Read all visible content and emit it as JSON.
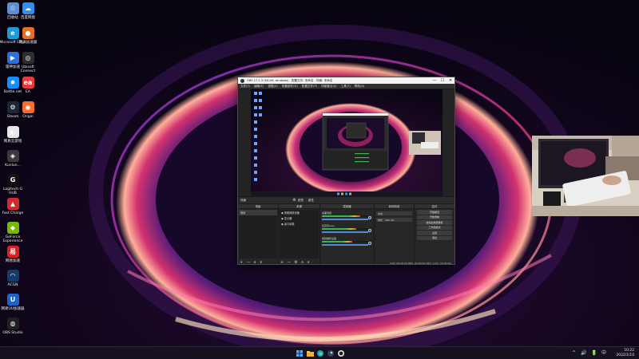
{
  "desktop": {
    "icons": [
      {
        "label": "回收站",
        "icon": "recycle-bin-icon",
        "color": "#5b8fd6",
        "glyph": "♲"
      },
      {
        "label": "百度网盘",
        "icon": "cloud-drive-icon",
        "color": "#2f8ef2",
        "glyph": "☁"
      },
      {
        "label": "Microsoft Edge",
        "icon": "edge-icon",
        "color": "#1f9ad8",
        "glyph": "e"
      },
      {
        "label": "腾讯加速器",
        "icon": "accelerator-icon",
        "color": "#e46f2a",
        "glyph": "●"
      },
      {
        "label": "雷神加速",
        "icon": "thunder-icon",
        "color": "#2c6fe0",
        "glyph": "▶"
      },
      {
        "label": "Ubisoft Connect",
        "icon": "ubisoft-icon",
        "color": "#2e2e2e",
        "glyph": "◎"
      },
      {
        "label": "Battle.net",
        "icon": "battlenet-icon",
        "color": "#148eff",
        "glyph": "✹"
      },
      {
        "label": "EA",
        "icon": "ea-icon",
        "color": "#e23b3b",
        "glyph": "ea"
      },
      {
        "label": "Steam",
        "icon": "steam-icon",
        "color": "#1b2838",
        "glyph": "⚙"
      },
      {
        "label": "Origin",
        "icon": "origin-icon",
        "color": "#f56c2d",
        "glyph": "◉"
      },
      {
        "label": "网易云游戏",
        "icon": "netease-cloud-icon",
        "color": "#e7e7e7",
        "glyph": "◐"
      },
      {
        "label": "Kunlun...",
        "icon": "kunlun-icon",
        "color": "#3a3a3a",
        "glyph": "◈"
      },
      {
        "label": "Logitech G HUB",
        "icon": "logitech-icon",
        "color": "#111111",
        "glyph": "G"
      },
      {
        "label": "Fast Charge",
        "icon": "fast-charge-icon",
        "color": "#d42a2a",
        "glyph": "▲"
      },
      {
        "label": "GeForce Experience",
        "icon": "geforce-icon",
        "color": "#76b900",
        "glyph": "◆"
      },
      {
        "label": "网易加速",
        "icon": "netease-acc-icon",
        "color": "#d92121",
        "glyph": "易"
      },
      {
        "label": "ACGN",
        "icon": "acgn-icon",
        "color": "#183a6a",
        "glyph": "◠"
      },
      {
        "label": "网易UU加速器",
        "icon": "uu-icon",
        "color": "#1e63c7",
        "glyph": "U"
      },
      {
        "label": "OBS Studio",
        "icon": "obs-icon",
        "color": "#202020",
        "glyph": "◍"
      }
    ]
  },
  "obs": {
    "title": "OBS 27.1.3 (64-bit, windows) - 配置文件: 未命名 - 场景: 未命名",
    "window_controls": {
      "minimize": "—",
      "maximize": "☐",
      "close": "✕"
    },
    "menu": [
      "文件(F)",
      "编辑(E)",
      "视图(V)",
      "停靠部件(D)",
      "配置文件(P)",
      "场景集合(S)",
      "工具(T)",
      "帮助(H)"
    ],
    "scene_bar": {
      "scene_name": "场景",
      "filters": "滤镜",
      "properties": "属性"
    },
    "docks": {
      "scenes": {
        "header": "场景",
        "items": [
          "场景"
        ],
        "tools": [
          "+",
          "—",
          "∧",
          "∨"
        ]
      },
      "sources": {
        "header": "来源",
        "items": [
          "视频捕获设备",
          "显示器",
          "窗口采集"
        ],
        "tools": [
          "+",
          "—",
          "⚙",
          "∧",
          "∨"
        ]
      },
      "mixer": {
        "header": "混音器",
        "channels": [
          {
            "label": "桌面音频",
            "level": 0.82
          },
          {
            "label": "麦克风/Aux",
            "level": 0.74
          },
          {
            "label": "视频捕获设备",
            "level": 0.66
          }
        ]
      },
      "transitions": {
        "header": "转场特效",
        "selected": "淡出",
        "duration_label": "时长",
        "duration": "300 ms"
      },
      "controls": {
        "header": "控件",
        "buttons": [
          "开始推流",
          "开始录制",
          "启动虚拟摄像机",
          "工作室模式",
          "设置",
          "退出"
        ]
      }
    },
    "status": "LIVE: 00:00:00  REC: 00:00:00  CPU: 1.2%, 30.00 fps"
  },
  "taskbar": {
    "icons": [
      "windows-start-icon",
      "file-explorer-icon",
      "edge-icon",
      "steam-icon",
      "obs-icon"
    ],
    "tray": [
      "^",
      "🔊",
      "🔋",
      "中"
    ],
    "time": "10:22",
    "date": "2022/1/10"
  },
  "colors": {
    "wallpaper_base": "#0b0614",
    "bloom_pink": "#ff3d8f",
    "bloom_purple": "#7a3cff",
    "obs_panel": "#262626",
    "taskbar": "#16121e"
  }
}
